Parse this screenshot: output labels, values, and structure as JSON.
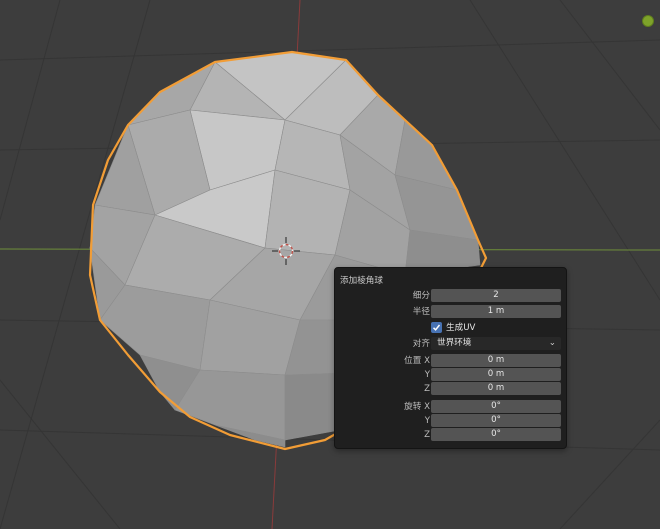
{
  "panel": {
    "title": "添加棱角球",
    "subdivisions": {
      "label": "细分",
      "value": "2"
    },
    "radius": {
      "label": "半径",
      "value": "1 m"
    },
    "generate_uv": {
      "label": "生成UV",
      "checked": true
    },
    "align": {
      "label": "对齐",
      "value": "世界环境"
    },
    "location": {
      "label": "位置",
      "x_label": "X",
      "y_label": "Y",
      "z_label": "Z",
      "x": "0 m",
      "y": "0 m",
      "z": "0 m"
    },
    "rotation": {
      "label": "旋转",
      "x_label": "X",
      "y_label": "Y",
      "z_label": "Z",
      "x": "0°",
      "y": "0°",
      "z": "0°"
    }
  },
  "icons": [
    "3d-cursor-icon",
    "checkmark-icon",
    "chevron-down-icon",
    "navigation-gizmo-icon"
  ],
  "colors": {
    "selection_outline": "#f29d36",
    "viewport_bg": "#3d3d3d",
    "checkbox": "#4772b3",
    "x_axis": "#8a3b3b",
    "y_axis": "#6f8f3a"
  }
}
